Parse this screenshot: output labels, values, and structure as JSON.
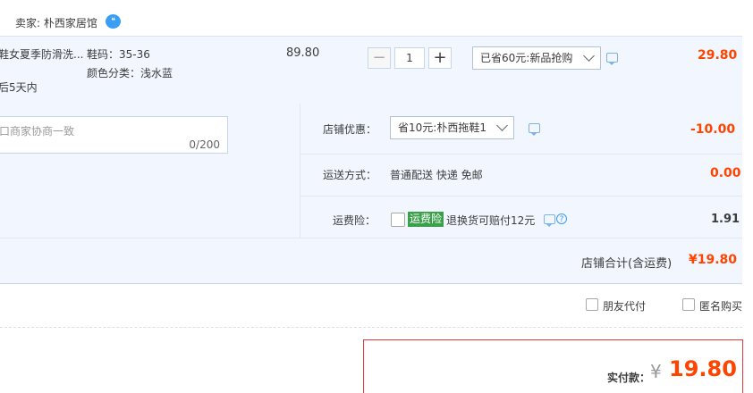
{
  "seller": {
    "label": "卖家: 朴西家居馆",
    "wangwang_icon": "chat-bubble-icon"
  },
  "item": {
    "title": "鞋女夏季防滑洗...",
    "delivery": "后5天内",
    "size": "鞋码：35-36",
    "color": "颜色分类：浅水蓝",
    "unit_price": "89.80",
    "quantity": "1",
    "minus": "−",
    "plus": "+",
    "promo_select": "已省60元:新品抢购",
    "subtotal": "29.80"
  },
  "memo": {
    "placeholder": "口商家协商一致",
    "counter": "0/200"
  },
  "shop_discount": {
    "label": "店铺优惠：",
    "select": "省10元:朴西拖鞋1",
    "amount": "-10.00"
  },
  "shipping": {
    "label": "运送方式：",
    "value": "普通配送 快递 免邮",
    "amount": "0.00"
  },
  "insurance": {
    "label": "运费险：",
    "badge": "运费险",
    "desc": "退换货可赔付12元",
    "amount": "1.91"
  },
  "shop_total": {
    "label": "店铺合计(含运费)",
    "amount": "¥19.80"
  },
  "options": {
    "friend_pay": "朋友代付",
    "anonymous": "匿名购买"
  },
  "payment": {
    "label": "实付款：",
    "currency": "¥",
    "amount": "19.80"
  },
  "colors": {
    "accent": "#ff4400",
    "row_bg": "#f1f6ff",
    "badge_green": "#3aa049",
    "pay_border": "#e4393c"
  }
}
